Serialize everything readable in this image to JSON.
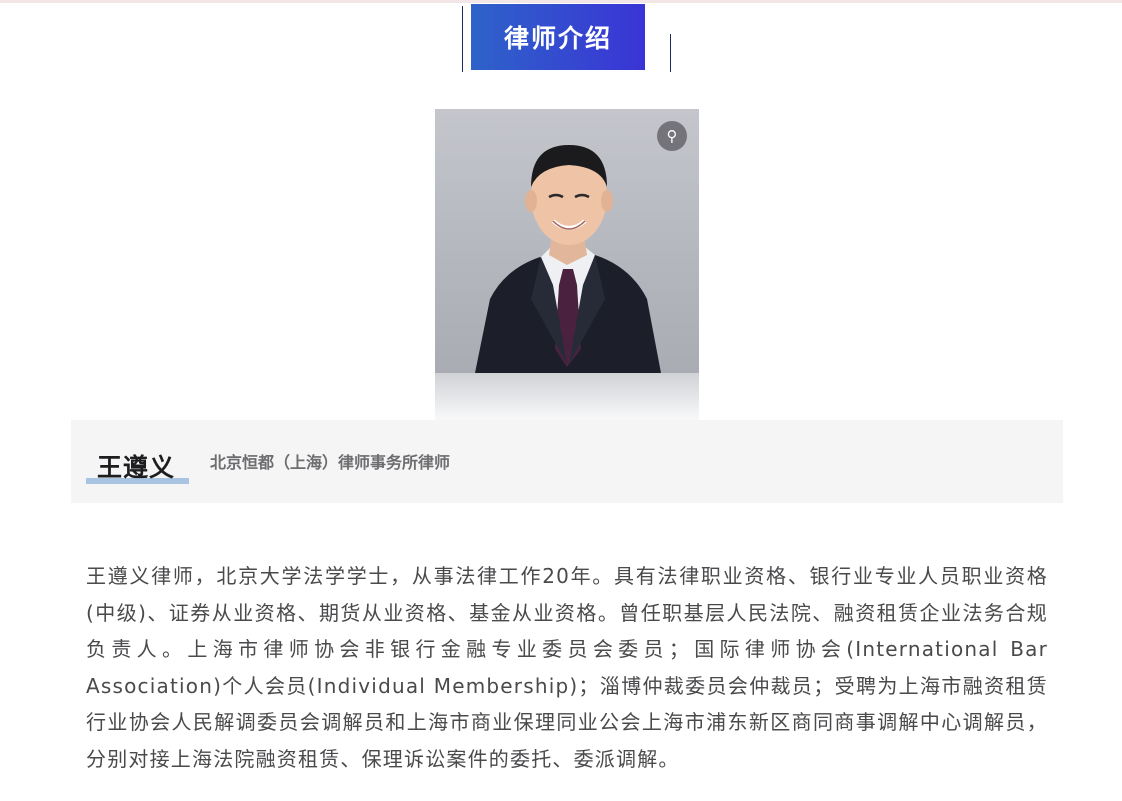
{
  "section": {
    "title": "律师介绍"
  },
  "photo": {
    "alt": "王遵义",
    "link_icon": "link-icon"
  },
  "lawyer": {
    "name": "王遵义",
    "title": "北京恒都（上海）律师事务所律师",
    "bio": "王遵义律师，北京大学法学学士，从事法律工作20年。具有法律职业资格、银行业专业人员职业资格(中级)、证券从业资格、期货从业资格、基金从业资格。曾任职基层人民法院、融资租赁企业法务合规负责人。上海市律师协会非银行金融专业委员会委员；国际律师协会(International Bar Association)个人会员(Individual Membership)；淄博仲裁委员会仲裁员；受聘为上海市融资租赁行业协会人民解调委员会调解员和上海市商业保理同业公会上海市浦东新区商同商事调解中心调解员，分别对接上海法院融资租赁、保理诉讼案件的委托、委派调解。"
  },
  "colors": {
    "accent": "#3a34d6",
    "underline": "#a9c4e3"
  }
}
